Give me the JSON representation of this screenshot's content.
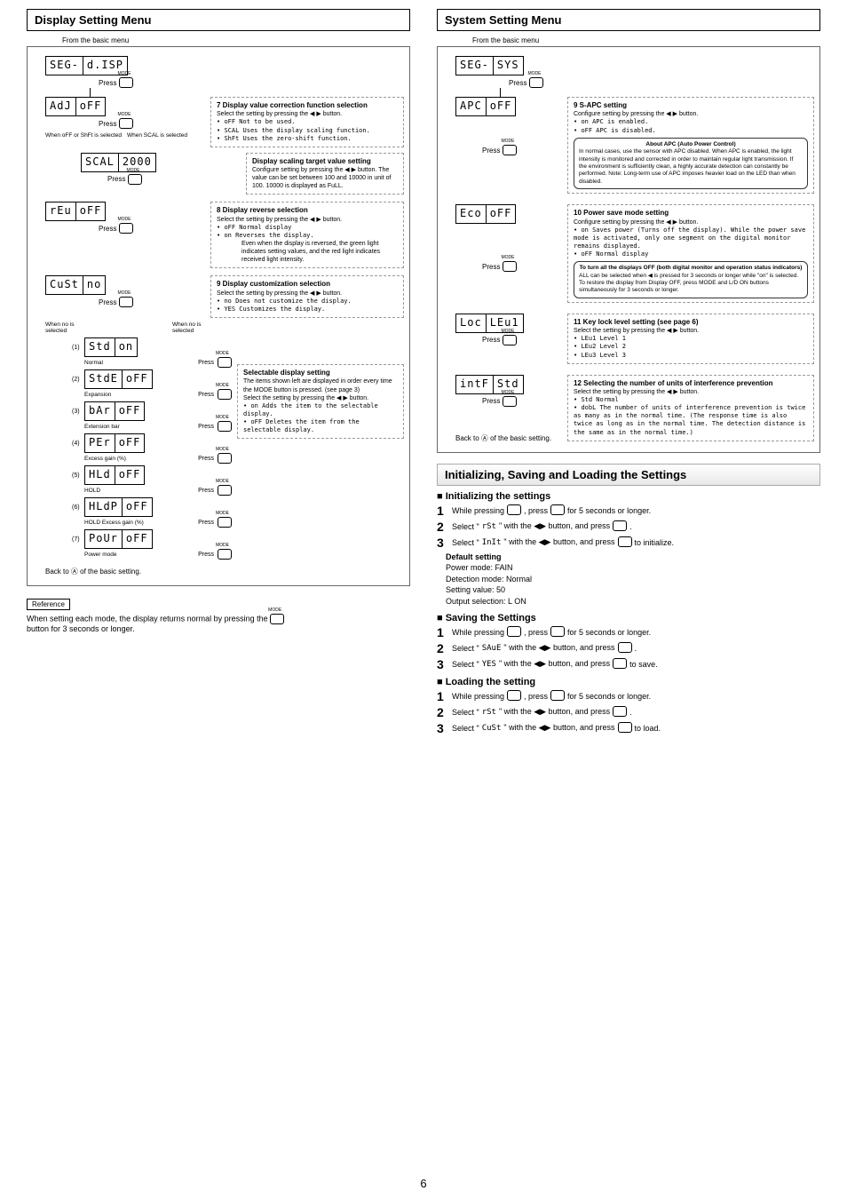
{
  "page_number": "6",
  "display_menu": {
    "title": "Display Setting Menu",
    "from": "From the basic menu",
    "seg_top": {
      "l": "SEG-",
      "r": "d.ISP"
    },
    "press": "Press",
    "adj": {
      "l": "AdJ",
      "r": "oFF"
    },
    "branch_text_left": "When oFF or ShFt is selected",
    "branch_text_right": "When SCAL is selected",
    "box7": {
      "title": "7  Display value correction function selection",
      "body_intro": "Select the setting by pressing the ◀ ▶ button.",
      "li1": "oFF   Not to be used.",
      "li2": "SCAL  Uses the display scaling function.",
      "li3": "ShFt  Uses the zero-shift function."
    },
    "scal": {
      "l": "SCAL",
      "r": "2000"
    },
    "box_scal": {
      "title": "Display scaling target value setting",
      "body": "Configure setting by pressing the ◀ ▶ button. The value can be set between 100 and 10000 in unit of 100. 10000 is displayed as FuLL."
    },
    "rev": {
      "l": "rEu",
      "r": "oFF"
    },
    "box8": {
      "title": "8  Display reverse selection",
      "body_intro": "Select the setting by pressing the ◀ ▶ button.",
      "li1": "oFF   Normal display",
      "li2": "on    Reverses the display.",
      "note": "Even when the display is reversed, the green light indicates setting values, and the red light indicates received light intensity."
    },
    "cust": {
      "l": "CuSt",
      "r": "no"
    },
    "box9": {
      "title": "9  Display customization selection",
      "body_intro": "Select the setting by pressing the ◀ ▶ button.",
      "li1": "no    Does not customize the display.",
      "li2": "YES   Customizes the display."
    },
    "branch_no": "When no is selected",
    "items": [
      {
        "n": "(1)",
        "l": "Std",
        "r": "on",
        "label": "Normal"
      },
      {
        "n": "(2)",
        "l": "StdE",
        "r": "oFF",
        "label": "Expansion"
      },
      {
        "n": "(3)",
        "l": "bAr",
        "r": "oFF",
        "label": "Extension bar"
      },
      {
        "n": "(4)",
        "l": "PEr",
        "r": "oFF",
        "label": "Excess gain (%)"
      },
      {
        "n": "(5)",
        "l": "HLd",
        "r": "oFF",
        "label": "HOLD"
      },
      {
        "n": "(6)",
        "l": "HLdP",
        "r": "oFF",
        "label": "HOLD Excess gain (%)"
      },
      {
        "n": "(7)",
        "l": "PoUr",
        "r": "oFF",
        "label": "Power mode"
      }
    ],
    "box_sel": {
      "title": "Selectable display setting",
      "body": "The items shown left are displayed in order every time the MODE button is pressed. (see page 3)",
      "body2": "Select the setting by pressing the ◀ ▶ button.",
      "li1": "on    Adds the item to the selectable display.",
      "li2": "oFF   Deletes the item from the selectable display."
    },
    "back": "Back to Ⓐ of the basic setting.",
    "ref": "Reference",
    "ref_note": "When setting each mode, the display returns normal by pressing the",
    "ref_note2": "button for 3 seconds or longer."
  },
  "system_menu": {
    "title": "System Setting Menu",
    "from": "From the basic menu",
    "seg_top": {
      "l": "SEG-",
      "r": "SYS"
    },
    "apc": {
      "l": "APC",
      "r": "oFF"
    },
    "box9s": {
      "title": "9  S-APC setting",
      "intro": "Configure setting by pressing the ◀ ▶ button.",
      "li1": "on    APC is enabled.",
      "li2": "oFF   APC is disabled.",
      "sub_title": "About APC (Auto Power Control)",
      "sub_body": "In normal cases, use the sensor with APC disabled. When APC is enabled, the light intensity is monitored and corrected in order to maintain regular light transmission. If the environment is sufficiently clean, a highly accurate detection can constantly be performed. Note: Long-term use of APC imposes heavier load on the LED than when disabled."
    },
    "eco": {
      "l": "Eco",
      "r": "oFF"
    },
    "box10": {
      "title": "10  Power save mode setting",
      "intro": "Configure setting by pressing the ◀ ▶ button.",
      "li1": "on    Saves power (Turns off the display). While the power save mode is activated, only one segment on the digital monitor remains displayed.",
      "li2": "oFF   Normal display",
      "sub_title": "To turn all the displays OFF (both digital monitor and operation status indicators)",
      "sub_body": "ALL can be selected when ◀ is pressed for 3 seconds or longer while \"on\" is selected. To restore the display from Display OFF, press MODE and L/D ON buttons simultaneously for 3 seconds or longer."
    },
    "loc": {
      "l": "Loc",
      "r": "LEu1"
    },
    "box11": {
      "title": "11  Key lock level setting (see page 6)",
      "intro": "Select the setting by pressing the ◀ ▶ button.",
      "li1": "LEu1  Level 1",
      "li2": "LEu2  Level 2",
      "li3": "LEu3  Level 3"
    },
    "intf": {
      "l": "intF",
      "r": "Std"
    },
    "box12": {
      "title": "12  Selecting the number of units of interference prevention",
      "intro": "Select the setting by pressing the ◀ ▶ button.",
      "li1": "Std   Normal",
      "li2": "dobL  The number of units of interference prevention is twice as many as in the normal time. (The response time is also twice as long as in the normal time. The detection distance is the same as in the normal time.)"
    },
    "back": "Back to Ⓐ of the basic setting."
  },
  "init": {
    "title": "Initializing, Saving and Loading the Settings",
    "h1": "Initializing the settings",
    "s1": "While pressing",
    "s1b": ", press",
    "s1c": "for 5 seconds or longer.",
    "s2a": "Select \"",
    "s2b": "rSt",
    "s2c": "\" with the  ◀▶  button, and press",
    "s3a": "Select \"",
    "s3b": "InIt",
    "s3c": "\" with the  ◀▶  button, and press",
    "s3d": "to initialize.",
    "def_title": "Default setting",
    "def1": "Power mode:        FAIN",
    "def2": "Detection mode:  Normal",
    "def3": "Setting value:       50",
    "def4": "Output selection: L ON",
    "h2": "Saving the Settings",
    "sv2b": "SAuE",
    "sv3b": "YES",
    "sv3d": "to save.",
    "h3": "Loading the setting",
    "ld2b": "rSt",
    "ld3b": "CuSt",
    "ld3d": "to load."
  }
}
